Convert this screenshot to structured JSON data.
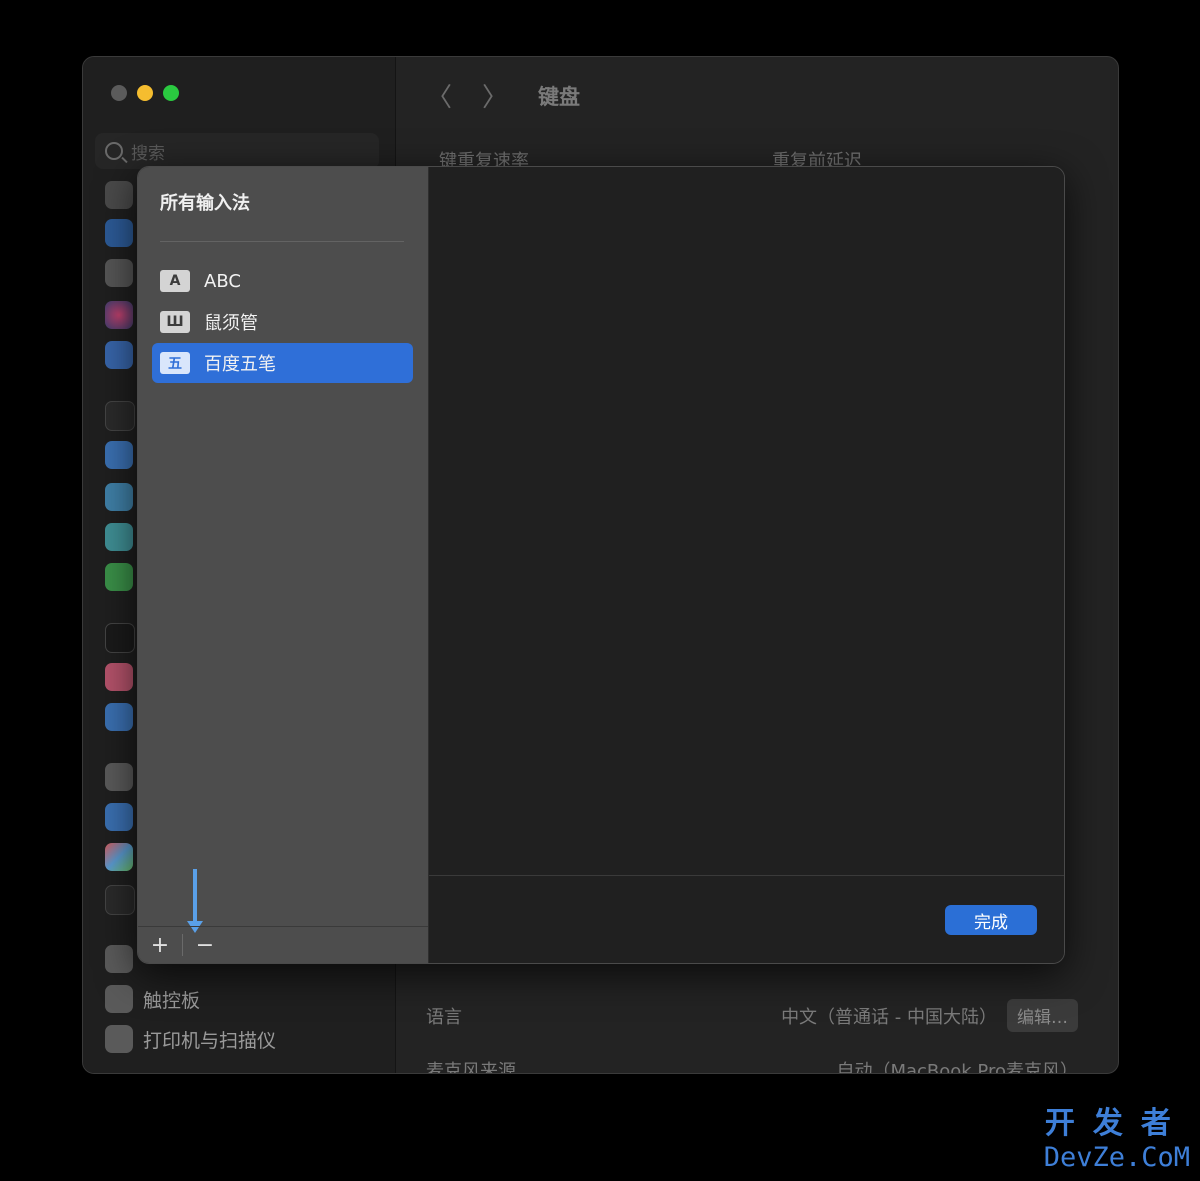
{
  "window": {
    "title": "键盘",
    "back": "〈",
    "forward": "〉"
  },
  "sidebar": {
    "search_placeholder": "搜索",
    "bottom_items": [
      {
        "label": "触控板"
      },
      {
        "label": "打印机与扫描仪"
      }
    ]
  },
  "background": {
    "repeat_rate_label": "键重复速率",
    "repeat_delay_label": "重复前延迟",
    "language_label": "语言",
    "language_value": "中文（普通话 - 中国大陆）",
    "language_edit": "编辑…",
    "mic_label": "麦克风来源",
    "mic_value": "自动（MacBook Pro麦克风）"
  },
  "sheet": {
    "title": "所有输入法",
    "input_methods": [
      {
        "badge": "A",
        "label": "ABC"
      },
      {
        "badge": "Ш",
        "label": "鼠须管"
      },
      {
        "badge": "五",
        "label": "百度五笔",
        "selected": true
      }
    ],
    "add": "+",
    "remove": "−",
    "done": "完成"
  },
  "watermark": {
    "line1": "开发者",
    "line2": "DevZe.CoM"
  },
  "colors": {
    "accent": "#2f6fd8",
    "arrow": "#5aa0e8"
  }
}
